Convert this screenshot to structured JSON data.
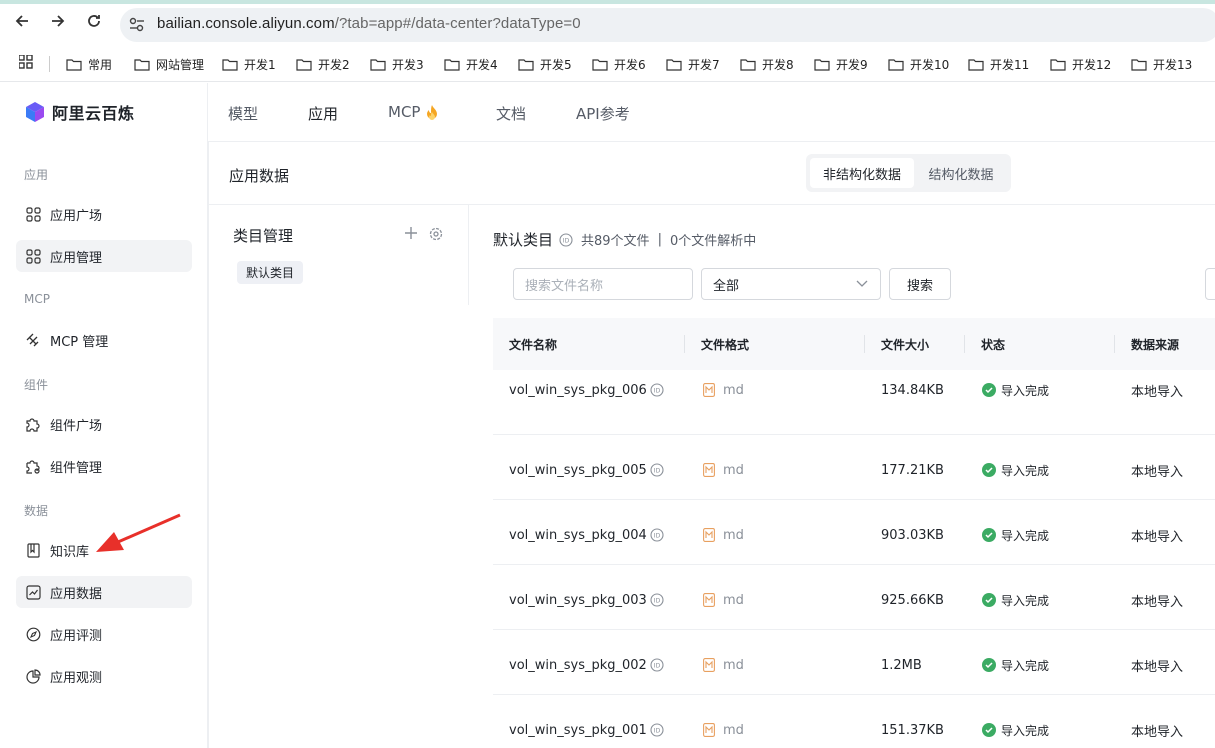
{
  "browser": {
    "url_main": "bailian.console.aliyun.com",
    "url_rest": "/?tab=app#/data-center?dataType=0",
    "bookmarks": [
      "常用",
      "网站管理",
      "开发1",
      "开发2",
      "开发3",
      "开发4",
      "开发5",
      "开发6",
      "开发7",
      "开发8",
      "开发9",
      "开发10",
      "开发11",
      "开发12",
      "开发13"
    ]
  },
  "brand": {
    "name": "阿里云百炼"
  },
  "topnav": {
    "items": [
      "模型",
      "应用",
      "MCP",
      "文档",
      "API参考"
    ],
    "active": "应用"
  },
  "sidebar": {
    "groups": [
      {
        "label": "应用",
        "items": [
          {
            "label": "应用广场",
            "icon": "grid-icon"
          },
          {
            "label": "应用管理",
            "icon": "grid-icon",
            "active": true
          }
        ]
      },
      {
        "label": "MCP",
        "items": [
          {
            "label": "MCP 管理",
            "icon": "mcp-icon"
          }
        ]
      },
      {
        "label": "组件",
        "items": [
          {
            "label": "组件广场",
            "icon": "puzzle-icon"
          },
          {
            "label": "组件管理",
            "icon": "puzzle-settings-icon"
          }
        ]
      },
      {
        "label": "数据",
        "items": [
          {
            "label": "知识库",
            "icon": "book-icon"
          },
          {
            "label": "应用数据",
            "icon": "chart-icon",
            "active": true
          },
          {
            "label": "应用评测",
            "icon": "compass-icon"
          },
          {
            "label": "应用观测",
            "icon": "pie-icon"
          }
        ]
      }
    ]
  },
  "page": {
    "title": "应用数据",
    "segments": [
      "非结构化数据",
      "结构化数据"
    ],
    "active_segment": "非结构化数据"
  },
  "category": {
    "title": "类目管理",
    "tag": "默认类目"
  },
  "files": {
    "heading": "默认类目",
    "count_text": "共89个文件",
    "separator": "|",
    "parsing_text": "0个文件解析中",
    "search_placeholder": "搜索文件名称",
    "filter_value": "全部",
    "search_button": "搜索",
    "columns": [
      "文件名称",
      "文件格式",
      "文件大小",
      "状态",
      "数据来源"
    ],
    "rows": [
      {
        "name": "vol_win_sys_pkg_006",
        "format": "md",
        "size": "134.84KB",
        "status": "导入完成",
        "source": "本地导入"
      },
      {
        "name": "vol_win_sys_pkg_005",
        "format": "md",
        "size": "177.21KB",
        "status": "导入完成",
        "source": "本地导入"
      },
      {
        "name": "vol_win_sys_pkg_004",
        "format": "md",
        "size": "903.03KB",
        "status": "导入完成",
        "source": "本地导入"
      },
      {
        "name": "vol_win_sys_pkg_003",
        "format": "md",
        "size": "925.66KB",
        "status": "导入完成",
        "source": "本地导入"
      },
      {
        "name": "vol_win_sys_pkg_002",
        "format": "md",
        "size": "1.2MB",
        "status": "导入完成",
        "source": "本地导入"
      },
      {
        "name": "vol_win_sys_pkg_001",
        "format": "md",
        "size": "151.37KB",
        "status": "导入完成",
        "source": "本地导入"
      }
    ]
  },
  "colors": {
    "success": "#3bab63",
    "format_icon": "#e8a060",
    "arrow": "#e8302a"
  }
}
